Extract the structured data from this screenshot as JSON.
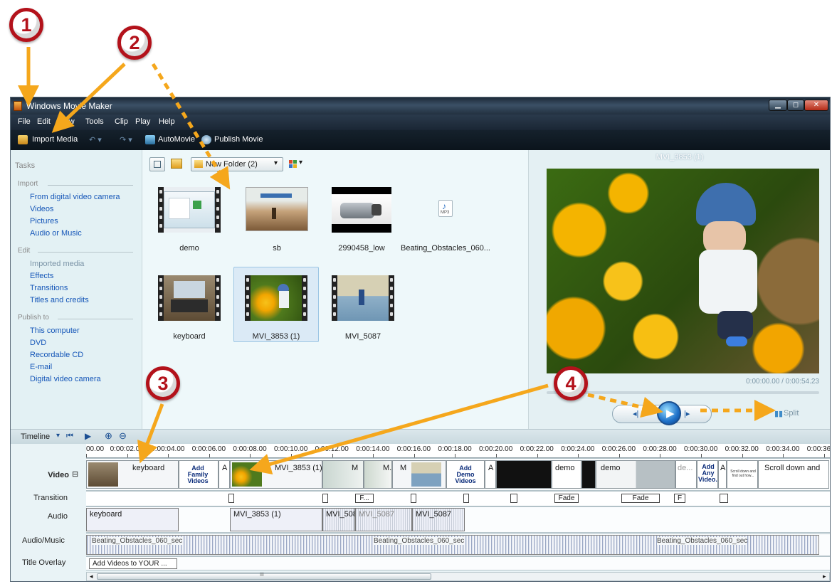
{
  "window": {
    "title": "Windows Movie Maker"
  },
  "menu": [
    "File",
    "Edit",
    "View",
    "Tools",
    "Clip",
    "Play",
    "Help"
  ],
  "toolbar": {
    "import_label": "Import Media",
    "automovie_label": "AutoMovie",
    "publish_label": "Publish Movie"
  },
  "tasks": {
    "header": "Tasks",
    "sections": [
      {
        "title": "Import",
        "items": [
          "From digital video camera",
          "Videos",
          "Pictures",
          "Audio or Music"
        ]
      },
      {
        "title": "Edit",
        "items": [
          "Imported media",
          "Effects",
          "Transitions",
          "Titles and credits"
        ]
      },
      {
        "title": "Publish to",
        "items": [
          "This computer",
          "DVD",
          "Recordable CD",
          "E-mail",
          "Digital video camera"
        ]
      }
    ]
  },
  "media": {
    "folder": "New Folder (2)",
    "items": [
      {
        "name": "demo",
        "kind": "video"
      },
      {
        "name": "sb",
        "kind": "image"
      },
      {
        "name": "2990458_low",
        "kind": "image"
      },
      {
        "name": "Beating_Obstacles_060...",
        "kind": "audio"
      },
      {
        "name": "keyboard",
        "kind": "video"
      },
      {
        "name": "MVI_3853 (1)",
        "kind": "video",
        "selected": true
      },
      {
        "name": "MVI_5087",
        "kind": "video"
      }
    ],
    "mp3_tag": "MP3"
  },
  "preview": {
    "title": "MVI_3853 (1)",
    "time": "0:00:00.00 / 0:00:54.23",
    "split_label": "Split"
  },
  "timeline": {
    "label": "Timeline",
    "ticks": [
      "00.00",
      "0:00:02.00",
      "0:00:04.00",
      "0:00:06.00",
      "0:00:08.00",
      "0:00:10.00",
      "0:00:12.00",
      "0:00:14.00",
      "0:00:16.00",
      "0:00:18.00",
      "0:00:20.00",
      "0:00:22.00",
      "0:00:24.00",
      "0:00:26.00",
      "0:00:28.00",
      "0:00:30.00",
      "0:00:32.00",
      "0:00:34.00",
      "0:00:36"
    ],
    "tracks": {
      "video": "Video",
      "transition": "Transition",
      "audio": "Audio",
      "music": "Audio/Music",
      "title": "Title Overlay"
    },
    "video_clips": {
      "keyboard": "keyboard",
      "add_family": "Add Family Videos",
      "a1": "A",
      "mvi3853": "MVI_3853 (1)",
      "m1": "M",
      "m2": "M.",
      "m3": "M",
      "add_demo": "Add Demo Videos",
      "a2": "A",
      "demo1": "demo",
      "demo2": "demo",
      "de": "de...",
      "add_any": "Add Any Video...",
      "a3": "A",
      "scroll_small": "Scroll down and find out how...",
      "scroll_down": "Scroll down and"
    },
    "transitions": {
      "f1": "F...",
      "fade1": "Fade",
      "fade2": "Fade",
      "f2": "F"
    },
    "audio_clips": {
      "keyboard": "keyboard",
      "mvi3853": "MVI_3853 (1)",
      "mvi5087a": "MVI_5087",
      "mvi5087b": "MVI_5087",
      "mvi5087c": "MVI_5087"
    },
    "music_clips": [
      "Beating_Obstacles_060_sec",
      "Beating_Obstacles_060_sec",
      "Beating_Obstacles_060_sec"
    ],
    "title_clip": "Add Videos to YOUR ...",
    "scroll_grip": "III"
  },
  "annotations": [
    "1",
    "2",
    "3",
    "4"
  ],
  "colors": {
    "accent": "#f5a71c",
    "badge_border": "#b3121b",
    "link": "#1556b8",
    "titlebar": "#22303f"
  }
}
